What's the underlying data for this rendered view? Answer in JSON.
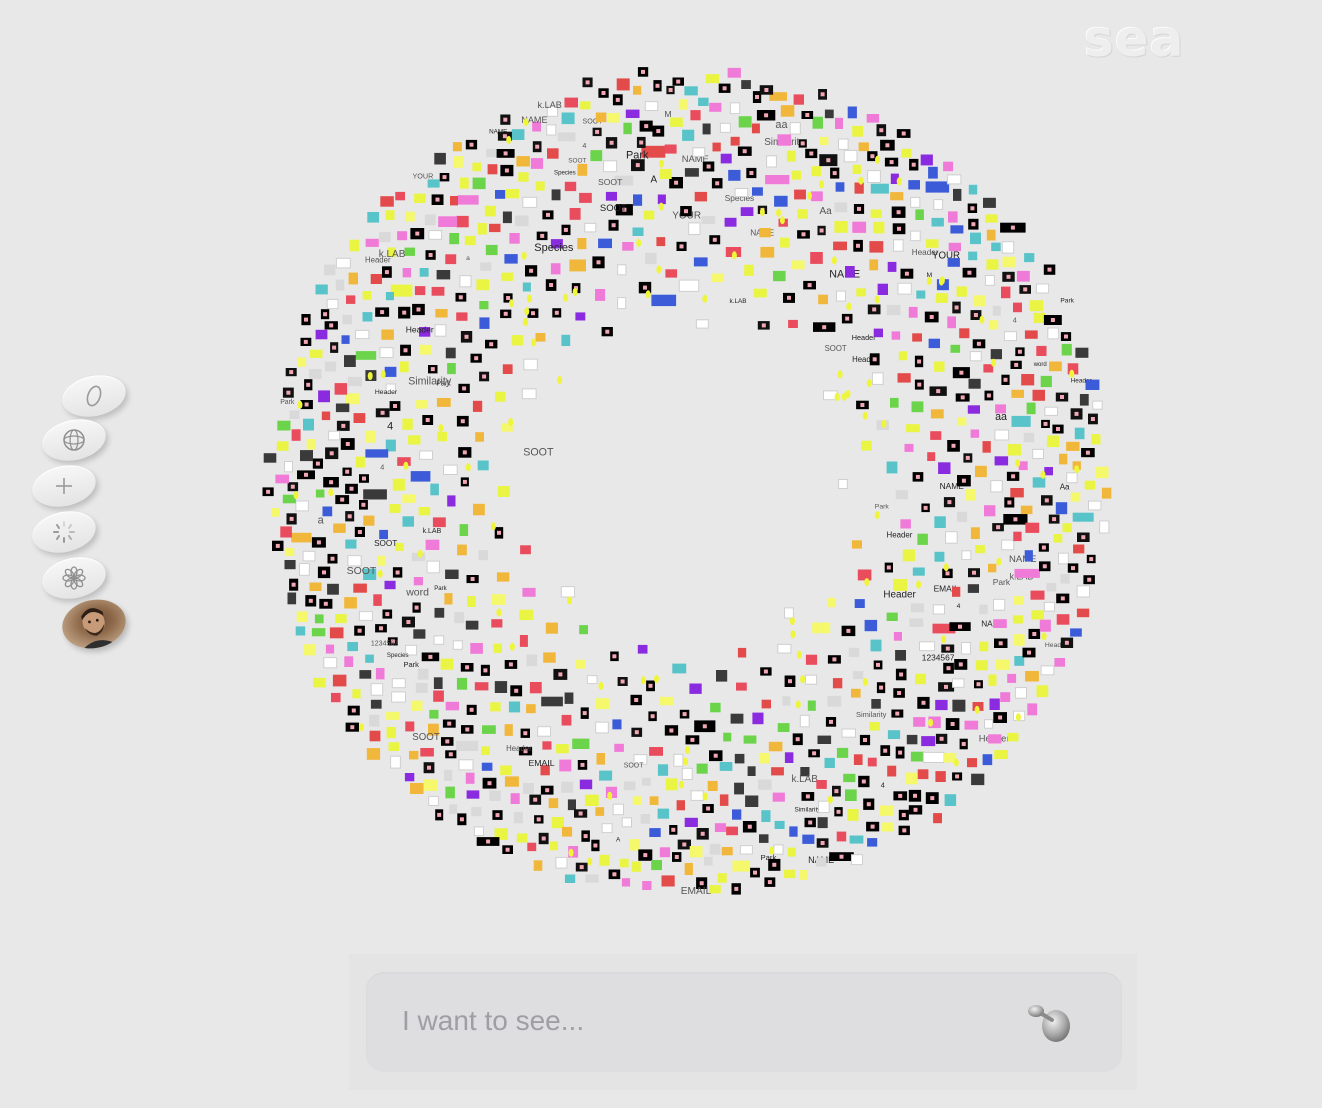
{
  "app": {
    "logo_text": "sea"
  },
  "sidebar": {
    "items": [
      {
        "name": "zero-icon",
        "label": "0"
      },
      {
        "name": "globe-icon"
      },
      {
        "name": "plus-icon"
      },
      {
        "name": "loading-spinner-icon"
      },
      {
        "name": "flower-icon"
      },
      {
        "name": "user-avatar"
      }
    ]
  },
  "cloud": {
    "labels": [
      "SOOT",
      "SOOT",
      "Park",
      "k.LAB",
      "Header",
      "Header",
      "Header",
      "Header",
      "NAME",
      "NAME",
      "NAME",
      "EMAIL",
      "YOUR",
      "Park",
      "k.LAB",
      "Park",
      "Species",
      "Species",
      "Similarity",
      "Similarity",
      "SOOT",
      "SOOT",
      "1234567",
      "4",
      "4",
      "4",
      "word",
      "Aa",
      "aa",
      "A",
      "a",
      "M"
    ]
  },
  "prompt": {
    "placeholder": "I want to see...",
    "value": ""
  }
}
